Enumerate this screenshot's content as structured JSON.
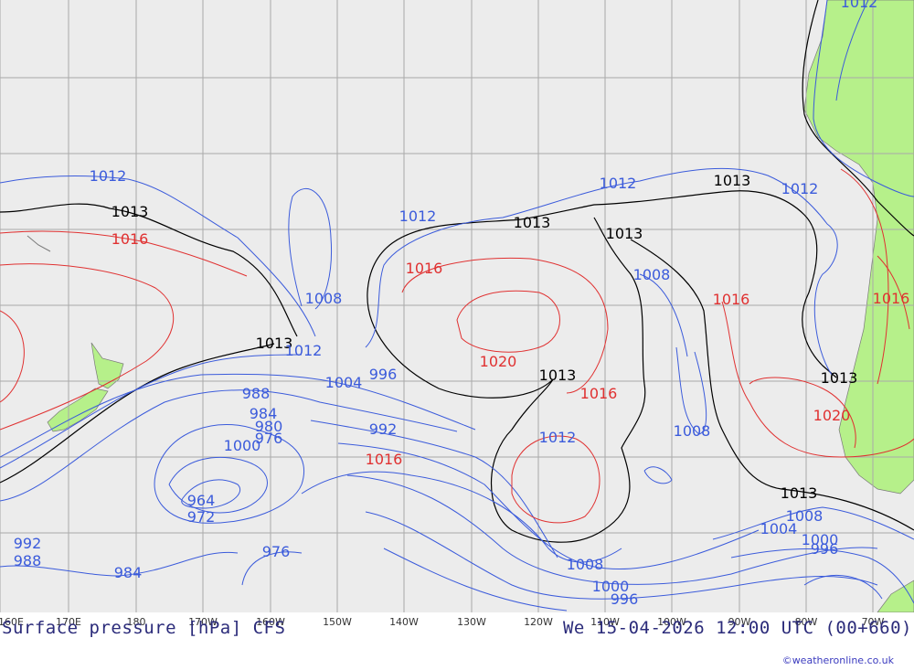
{
  "map": {
    "footer_title": "Surface pressure [hPa] CFS",
    "footer_datetime": "We 15-04-2026 12:00 UTC (00+660)",
    "credit": "©weatheronline.co.uk",
    "longitude_labels": [
      "160E",
      "170E",
      "180",
      "170W",
      "160W",
      "150W",
      "140W",
      "130W",
      "120W",
      "110W",
      "100W",
      "90W",
      "80W",
      "70W"
    ],
    "colors": {
      "ocean": "#ececec",
      "land": "#b6f08a",
      "grid": "#a9a9a9",
      "low_isobar": "#3b5bdb",
      "high_isobar": "#e03131",
      "mean_isobar": "#000000"
    },
    "isobar_labels": [
      {
        "text": "1012",
        "kind": "blue"
      },
      {
        "text": "1013",
        "kind": "black"
      },
      {
        "text": "1016",
        "kind": "red"
      },
      {
        "text": "1012",
        "kind": "blue"
      },
      {
        "text": "1013",
        "kind": "black"
      },
      {
        "text": "1012",
        "kind": "blue"
      },
      {
        "text": "1013",
        "kind": "black"
      },
      {
        "text": "1016",
        "kind": "red"
      },
      {
        "text": "1008",
        "kind": "blue"
      },
      {
        "text": "1013",
        "kind": "black"
      },
      {
        "text": "1012",
        "kind": "blue"
      },
      {
        "text": "1020",
        "kind": "red"
      },
      {
        "text": "1013",
        "kind": "black"
      },
      {
        "text": "1016",
        "kind": "red"
      },
      {
        "text": "1008",
        "kind": "blue"
      },
      {
        "text": "1004",
        "kind": "blue"
      },
      {
        "text": "996",
        "kind": "blue"
      },
      {
        "text": "988",
        "kind": "blue"
      },
      {
        "text": "984",
        "kind": "blue"
      },
      {
        "text": "980",
        "kind": "blue"
      },
      {
        "text": "976",
        "kind": "blue"
      },
      {
        "text": "1000",
        "kind": "blue"
      },
      {
        "text": "992",
        "kind": "blue"
      },
      {
        "text": "1016",
        "kind": "red"
      },
      {
        "text": "1012",
        "kind": "blue"
      },
      {
        "text": "1008",
        "kind": "blue"
      },
      {
        "text": "1016",
        "kind": "red"
      },
      {
        "text": "1013",
        "kind": "black"
      },
      {
        "text": "1020",
        "kind": "red"
      },
      {
        "text": "1016",
        "kind": "red"
      },
      {
        "text": "1013",
        "kind": "black"
      },
      {
        "text": "1012",
        "kind": "blue"
      },
      {
        "text": "1008",
        "kind": "blue"
      },
      {
        "text": "1004",
        "kind": "blue"
      },
      {
        "text": "1000",
        "kind": "blue"
      },
      {
        "text": "996",
        "kind": "blue"
      },
      {
        "text": "1013",
        "kind": "black"
      },
      {
        "text": "1008",
        "kind": "blue"
      },
      {
        "text": "1000",
        "kind": "blue"
      },
      {
        "text": "996",
        "kind": "blue"
      },
      {
        "text": "964",
        "kind": "blue"
      },
      {
        "text": "972",
        "kind": "blue"
      },
      {
        "text": "976",
        "kind": "blue"
      },
      {
        "text": "992",
        "kind": "blue"
      },
      {
        "text": "988",
        "kind": "blue"
      },
      {
        "text": "984",
        "kind": "blue"
      },
      {
        "text": "1012",
        "kind": "blue"
      }
    ]
  }
}
